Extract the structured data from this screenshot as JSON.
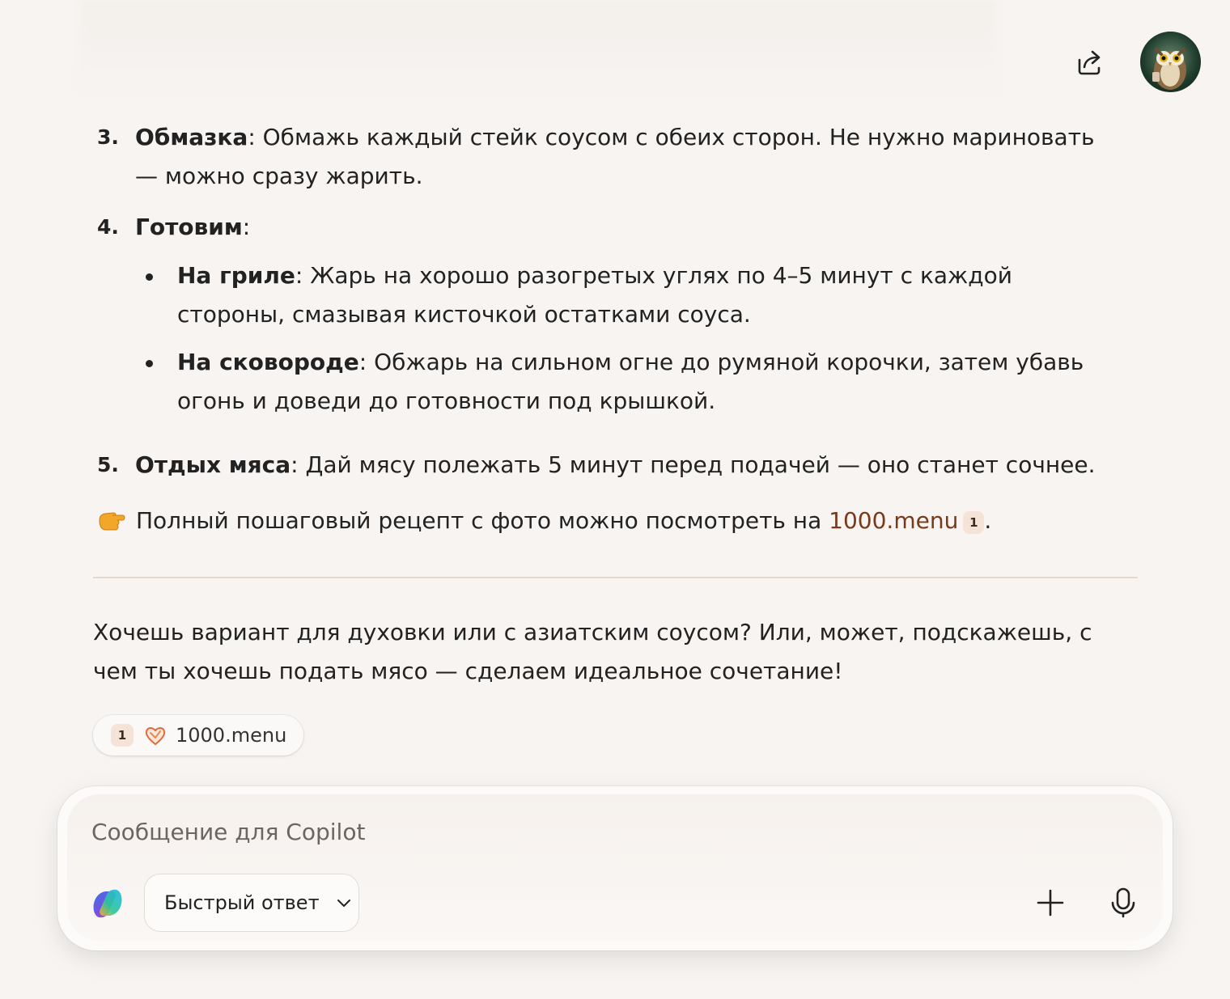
{
  "header": {
    "share_icon": "share-icon",
    "avatar_icon": "owl-avatar"
  },
  "steps": [
    {
      "num": "3.",
      "title": "Обмазка",
      "text": ": Обмажь каждый стейк соусом с обеих сторон. Не нужно мариновать — можно сразу жарить."
    },
    {
      "num": "4.",
      "title": "Готовим",
      "text": ":",
      "bullets": [
        {
          "title": "На гриле",
          "text": ": Жарь на хорошо разогретых углях по 4–5 минут с каждой стороны, смазывая кисточкой остатками соуса."
        },
        {
          "title": "На сковороде",
          "text": ": Обжарь на сильном огне до румяной корочки, затем убавь огонь и доведи до готовности под крышкой."
        }
      ]
    },
    {
      "num": "5.",
      "title": "Отдых мяса",
      "text": ": Дай мясу полежать 5 минут перед подачей — оно станет сочнее."
    }
  ],
  "note": {
    "emoji": "pointing-hand-icon",
    "text": "Полный пошаговый рецепт с фото можно посмотреть на ",
    "link": "1000.menu",
    "cite": "1",
    "end": "."
  },
  "followup": "Хочешь вариант для духовки или с азиатским соусом? Или, может, подскажешь, с чем ты хочешь подать мясо — сделаем идеальное сочетание!",
  "sources": [
    {
      "num": "1",
      "icon": "heart-logo-icon",
      "label": "1000.menu"
    }
  ],
  "composer": {
    "placeholder": "Сообщение для Copilot",
    "mode": "Быстрый ответ"
  },
  "colors": {
    "background": "#f7f4f1",
    "link": "#7a3a1a",
    "cite_badge": "#f4e3d6"
  }
}
